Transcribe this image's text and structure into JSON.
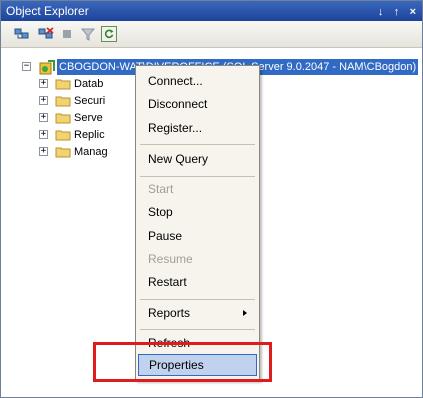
{
  "window": {
    "title": "Object Explorer",
    "title_buttons": {
      "pin": "↓",
      "autohide": "↑",
      "close": "×"
    }
  },
  "toolbar": {
    "icons": [
      "connect-icon",
      "disconnect-icon",
      "stop-icon",
      "filter-icon",
      "refresh-icon"
    ]
  },
  "tree": {
    "server": {
      "label": "CBOGDON-WAT\\DIVEROFFICE (SQL Server 9.0.2047 - NAM\\CBogdon)",
      "expander": "−"
    },
    "children": [
      {
        "label": "Datab",
        "expander": "+"
      },
      {
        "label": "Securi",
        "expander": "+"
      },
      {
        "label": "Serve",
        "expander": "+"
      },
      {
        "label": "Replic",
        "expander": "+"
      },
      {
        "label": "Manag",
        "expander": "+"
      }
    ]
  },
  "context_menu": {
    "items": [
      {
        "label": "Connect...",
        "disabled": false
      },
      {
        "label": "Disconnect",
        "disabled": false
      },
      {
        "label": "Register...",
        "disabled": false
      },
      {
        "label": "New Query",
        "disabled": false
      },
      {
        "label": "Start",
        "disabled": true
      },
      {
        "label": "Stop",
        "disabled": false
      },
      {
        "label": "Pause",
        "disabled": false
      },
      {
        "label": "Resume",
        "disabled": true
      },
      {
        "label": "Restart",
        "disabled": false
      },
      {
        "label": "Reports",
        "disabled": false,
        "has_submenu": true
      },
      {
        "label": "Refresh",
        "disabled": false
      },
      {
        "label": "Properties",
        "disabled": false,
        "highlighted": true
      }
    ]
  },
  "colors": {
    "title_bar": "#2a57b0",
    "selection": "#316ac5",
    "menu_background": "#f6f4ec",
    "annotation": "#e01b1b",
    "folder": "#f2d272"
  }
}
